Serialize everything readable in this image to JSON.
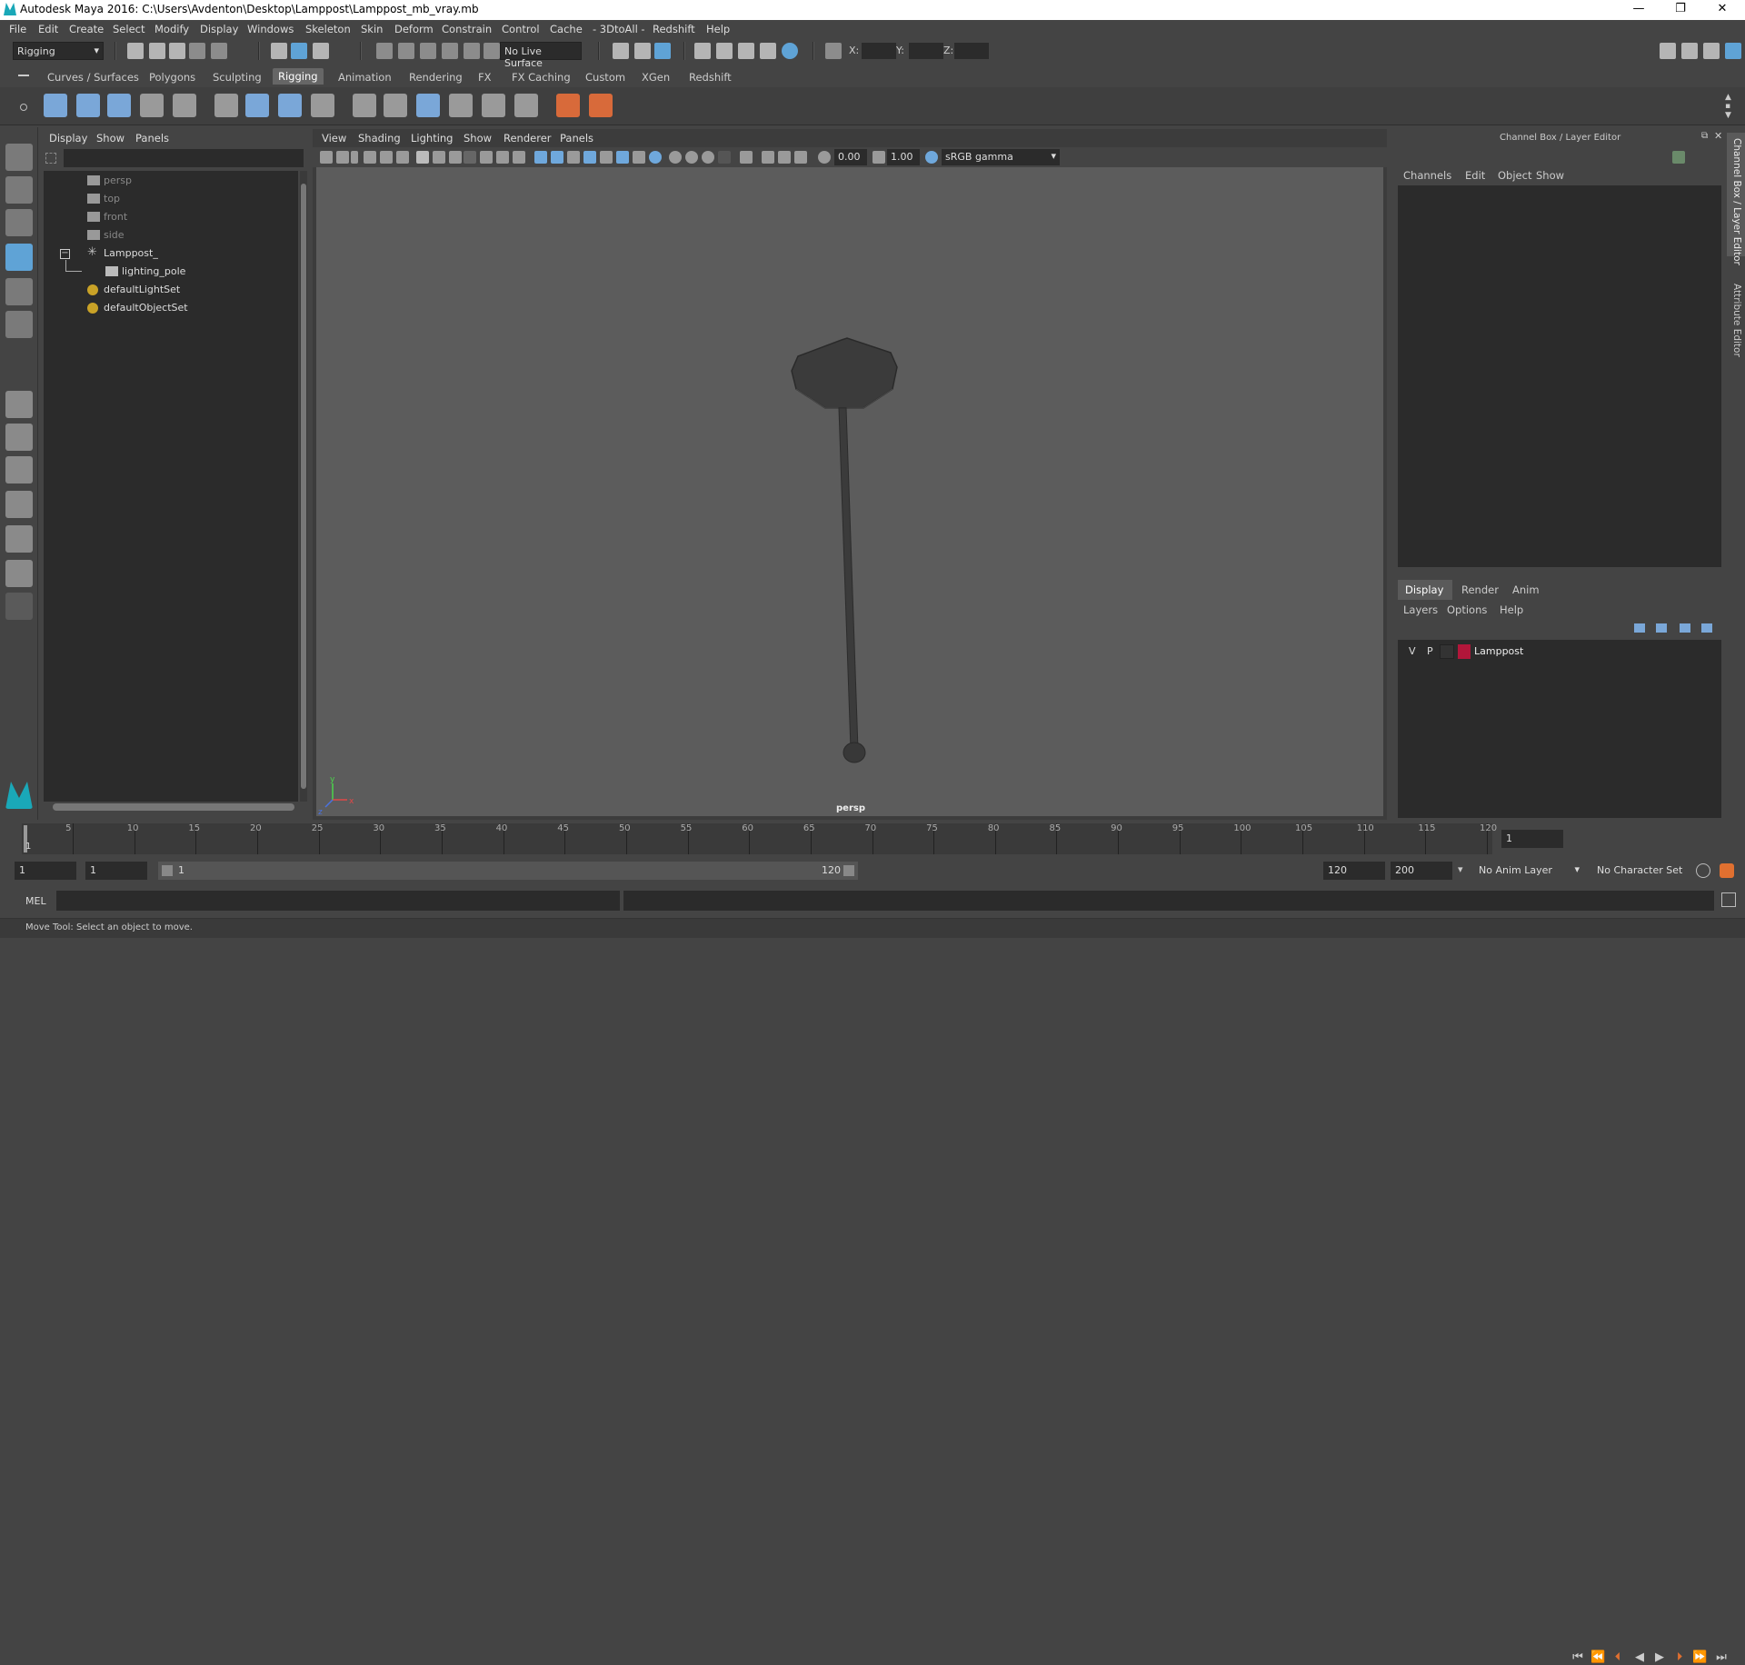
{
  "window": {
    "title": "Autodesk Maya 2016: C:\\Users\\Avdenton\\Desktop\\Lamppost\\Lamppost_mb_vray.mb",
    "minimize": "—",
    "maximize": "❐",
    "close": "✕"
  },
  "menubar": [
    "File",
    "Edit",
    "Create",
    "Select",
    "Modify",
    "Display",
    "Windows",
    "Skeleton",
    "Skin",
    "Deform",
    "Constrain",
    "Control",
    "Cache",
    "- 3DtoAll -",
    "Redshift",
    "Help"
  ],
  "status_line": {
    "mode": "Rigging",
    "live_surface": "No Live Surface",
    "x_label": "X:",
    "y_label": "Y:",
    "z_label": "Z:"
  },
  "shelf_tabs": [
    "Curves / Surfaces",
    "Polygons",
    "Sculpting",
    "Rigging",
    "Animation",
    "Rendering",
    "FX",
    "FX Caching",
    "Custom",
    "XGen",
    "Redshift"
  ],
  "active_shelf": "Rigging",
  "outliner": {
    "menu": [
      "Display",
      "Show",
      "Panels"
    ],
    "items": [
      {
        "label": "persp",
        "type": "camera",
        "dim": true,
        "indent": 0
      },
      {
        "label": "top",
        "type": "camera",
        "dim": true,
        "indent": 0
      },
      {
        "label": "front",
        "type": "camera",
        "dim": true,
        "indent": 0
      },
      {
        "label": "side",
        "type": "camera",
        "dim": true,
        "indent": 0
      },
      {
        "label": "Lamppost_",
        "type": "group",
        "dim": false,
        "indent": 0
      },
      {
        "label": "lighting_pole",
        "type": "mesh",
        "dim": false,
        "indent": 1
      },
      {
        "label": "defaultLightSet",
        "type": "set",
        "dim": false,
        "indent": 0
      },
      {
        "label": "defaultObjectSet",
        "type": "set",
        "dim": false,
        "indent": 0
      }
    ]
  },
  "viewport": {
    "menu": [
      "View",
      "Shading",
      "Lighting",
      "Show",
      "Renderer",
      "Panels"
    ],
    "exposure": "0.00",
    "gamma": "1.00",
    "color_space": "sRGB gamma",
    "camera_label": "persp",
    "axis_y": "y",
    "axis_x": "x",
    "axis_z": "z"
  },
  "channel_box": {
    "title": "Channel Box / Layer Editor",
    "menu": [
      "Channels",
      "Edit",
      "Object",
      "Show"
    ],
    "layer_tabs": [
      "Display",
      "Render",
      "Anim"
    ],
    "layer_menu": [
      "Layers",
      "Options",
      "Help"
    ],
    "layers": [
      {
        "v": "V",
        "p": "P",
        "name": "Lamppost",
        "color": "#b2163a"
      }
    ],
    "side_tab_1": "Channel Box / Layer Editor",
    "side_tab_2": "Attribute Editor"
  },
  "time_slider": {
    "ticks": [
      "5",
      "10",
      "15",
      "20",
      "25",
      "30",
      "35",
      "40",
      "45",
      "50",
      "55",
      "60",
      "65",
      "70",
      "75",
      "80",
      "85",
      "90",
      "95",
      "100",
      "105",
      "110",
      "115",
      "120"
    ],
    "current_marker": "1",
    "current_frame": "1"
  },
  "range_slider": {
    "start": "1",
    "playback_start": "1",
    "range_start_label": "1",
    "range_end_label": "120",
    "playback_end": "120",
    "end": "200",
    "anim_layer": "No Anim Layer",
    "character_set": "No Character Set"
  },
  "command_line": {
    "label": "MEL"
  },
  "help_line": {
    "text": "Move Tool: Select an object to move."
  },
  "colors": {
    "accent": "#5fa3d6",
    "layer_color": "#b2163a"
  }
}
